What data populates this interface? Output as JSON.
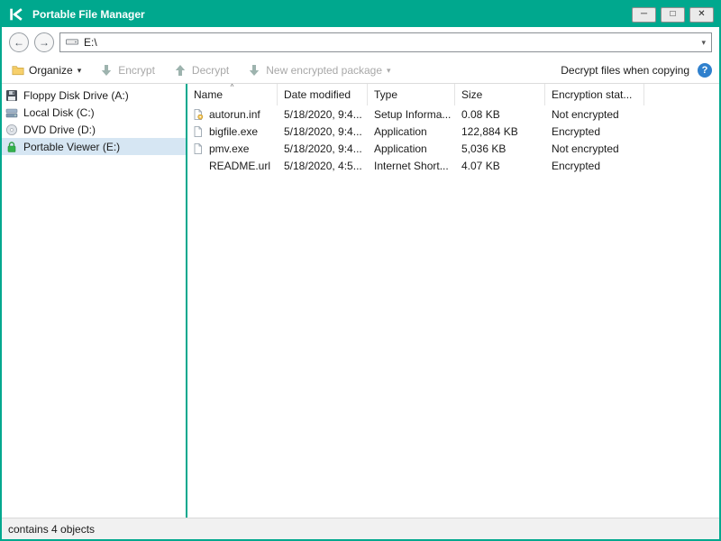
{
  "window": {
    "title": "Portable File Manager",
    "controls": {
      "minimize": "─",
      "maximize": "□",
      "close": "✕"
    }
  },
  "icons": {
    "back": "←",
    "forward": "→",
    "chevron_down": "▾",
    "sort_asc": "^",
    "help": "?"
  },
  "navbar": {
    "address": "E:\\"
  },
  "toolbar": {
    "organize_label": "Organize",
    "encrypt_label": "Encrypt",
    "decrypt_label": "Decrypt",
    "new_package_label": "New encrypted package",
    "decrypt_when_copying_label": "Decrypt files when copying"
  },
  "sidebar": {
    "items": [
      {
        "label": "Floppy Disk Drive (A:)",
        "icon": "floppy-disk-icon",
        "selected": false
      },
      {
        "label": "Local Disk (C:)",
        "icon": "hard-disk-icon",
        "selected": false
      },
      {
        "label": "DVD Drive (D:)",
        "icon": "dvd-disc-icon",
        "selected": false
      },
      {
        "label": "Portable Viewer (E:)",
        "icon": "lock-icon",
        "selected": true
      }
    ]
  },
  "filelist": {
    "columns": [
      "Name",
      "Date modified",
      "Type",
      "Size",
      "Encryption stat..."
    ],
    "rows": [
      {
        "name": "autorun.inf",
        "date": "5/18/2020, 9:4...",
        "type": "Setup Informa...",
        "size": "0.08 KB",
        "encryption": "Not encrypted",
        "icon": "setup-information-file-icon"
      },
      {
        "name": "bigfile.exe",
        "date": "5/18/2020, 9:4...",
        "type": "Application",
        "size": "122,884 KB",
        "encryption": "Encrypted",
        "icon": "application-file-icon"
      },
      {
        "name": "pmv.exe",
        "date": "5/18/2020, 9:4...",
        "type": "Application",
        "size": "5,036 KB",
        "encryption": "Not encrypted",
        "icon": "application-file-icon"
      },
      {
        "name": "README.url",
        "date": "5/18/2020, 4:5...",
        "type": "Internet Short...",
        "size": "4.07 KB",
        "encryption": "Encrypted",
        "icon": "none"
      }
    ]
  },
  "statusbar": {
    "text": "contains 4 objects"
  },
  "colors": {
    "brand_teal": "#00a88e",
    "selection": "#d6e6f3",
    "help_blue": "#2f80cd",
    "disabled_text": "#a8a8a8"
  }
}
